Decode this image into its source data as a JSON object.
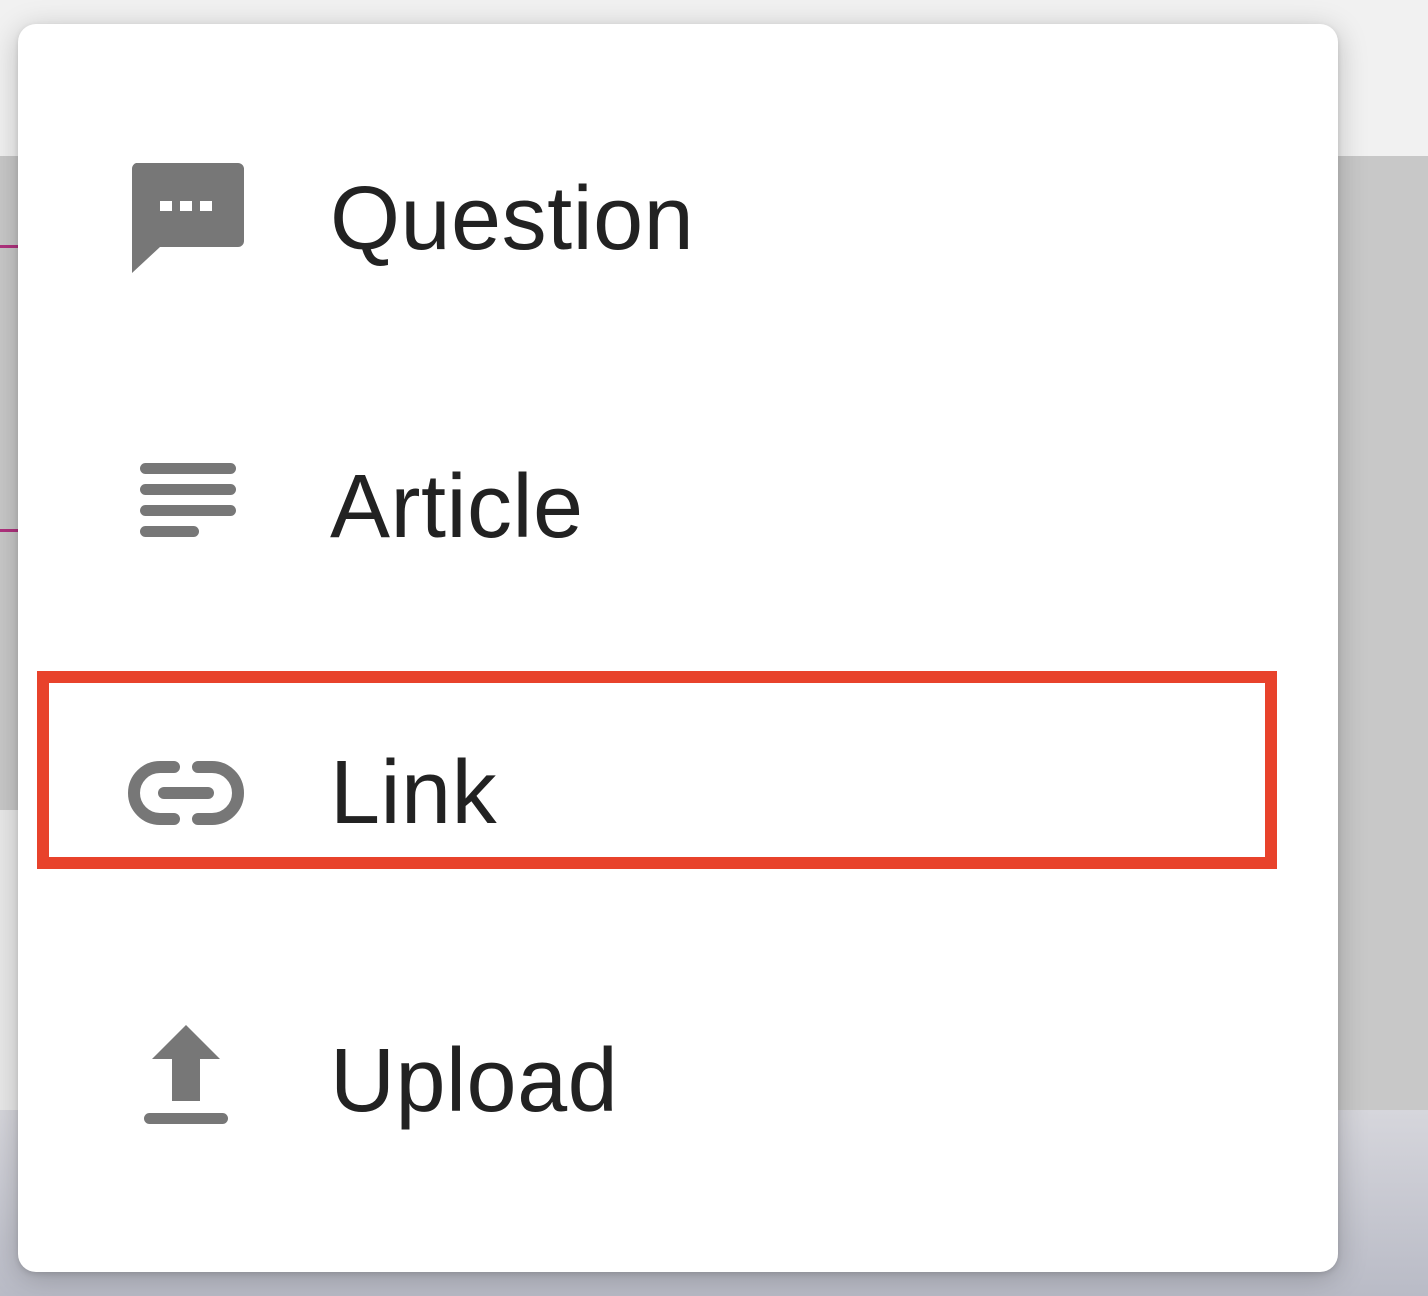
{
  "menu": {
    "items": [
      {
        "label": "Question",
        "icon": "question-icon"
      },
      {
        "label": "Article",
        "icon": "article-icon"
      },
      {
        "label": "Link",
        "icon": "link-icon",
        "highlighted": true
      },
      {
        "label": "Upload",
        "icon": "upload-icon"
      }
    ]
  },
  "colors": {
    "highlight": "#e8422b",
    "icon": "#777777",
    "text": "#222222"
  }
}
